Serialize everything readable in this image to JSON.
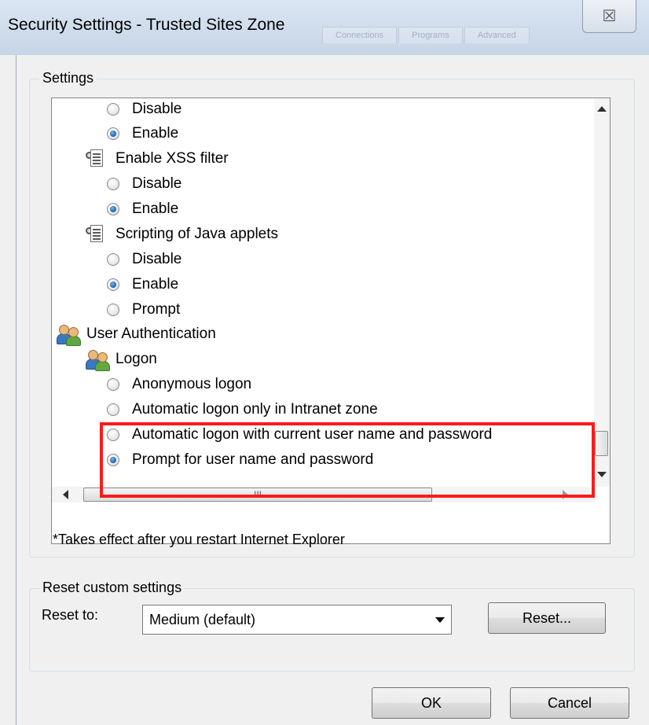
{
  "window": {
    "title": "Security Settings - Trusted Sites Zone",
    "close_glyph": "☒",
    "background_tabs": [
      "Connections",
      "Programs",
      "Advanced"
    ]
  },
  "settings": {
    "group_label": "Settings",
    "rows": [
      {
        "kind": "radio",
        "label": "Disable",
        "checked": false
      },
      {
        "kind": "radio",
        "label": "Enable",
        "checked": true
      },
      {
        "kind": "category",
        "icon": "settings-document-icon",
        "label": "Enable XSS filter"
      },
      {
        "kind": "radio",
        "label": "Disable",
        "checked": false
      },
      {
        "kind": "radio",
        "label": "Enable",
        "checked": true
      },
      {
        "kind": "category",
        "icon": "settings-document-icon",
        "label": "Scripting of Java applets"
      },
      {
        "kind": "radio",
        "label": "Disable",
        "checked": false
      },
      {
        "kind": "radio",
        "label": "Enable",
        "checked": true
      },
      {
        "kind": "radio",
        "label": "Prompt",
        "checked": false
      },
      {
        "kind": "category",
        "icon": "users-icon",
        "label": "User Authentication"
      },
      {
        "kind": "category",
        "icon": "users-icon",
        "label": "Logon"
      },
      {
        "kind": "radio",
        "label": "Anonymous logon",
        "checked": false
      },
      {
        "kind": "radio",
        "label": "Automatic logon only in Intranet zone",
        "checked": false
      },
      {
        "kind": "radio",
        "label": "Automatic logon with current user name and password",
        "checked": false
      },
      {
        "kind": "radio",
        "label": "Prompt for user name and password",
        "checked": true
      }
    ],
    "hscroll_grip": "III",
    "footnote": "*Takes effect after you restart Internet Explorer"
  },
  "reset": {
    "group_label": "Reset custom settings",
    "reset_to_label": "Reset to:",
    "selected_level": "Medium (default)",
    "reset_button": "Reset..."
  },
  "buttons": {
    "ok": "OK",
    "cancel": "Cancel"
  },
  "annotation": {
    "highlight_color": "#ff1a1a"
  }
}
